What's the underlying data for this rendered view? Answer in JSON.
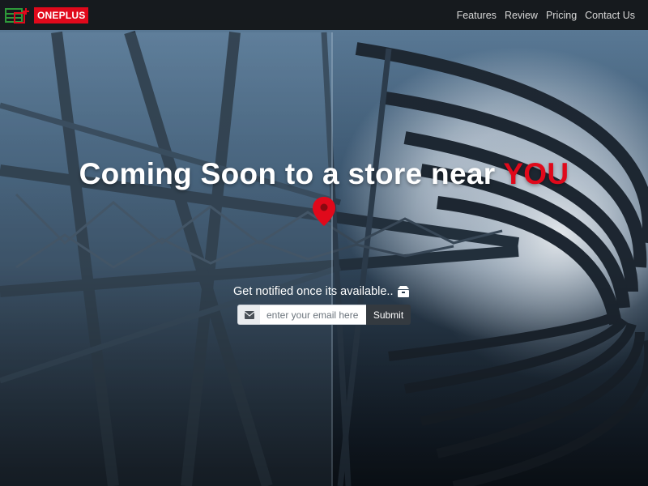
{
  "brand": {
    "logo_icon": "oneplus-logo-icon",
    "name": "ONEPLUS"
  },
  "nav": {
    "links": [
      {
        "label": "Features"
      },
      {
        "label": "Review"
      },
      {
        "label": "Pricing"
      },
      {
        "label": "Contact Us"
      }
    ]
  },
  "hero": {
    "title_main": "Coming Soon to a store near ",
    "title_accent": "YOU",
    "pin_icon": "map-pin-icon",
    "notify_text": "Get notified once its available..",
    "notify_icon": "box-icon"
  },
  "form": {
    "mail_icon": "envelope-icon",
    "email_placeholder": "enter your email here",
    "submit_label": "Submit"
  },
  "colors": {
    "accent": "#e0091b",
    "navbar": "#0c0c0c",
    "button": "#343a40"
  }
}
